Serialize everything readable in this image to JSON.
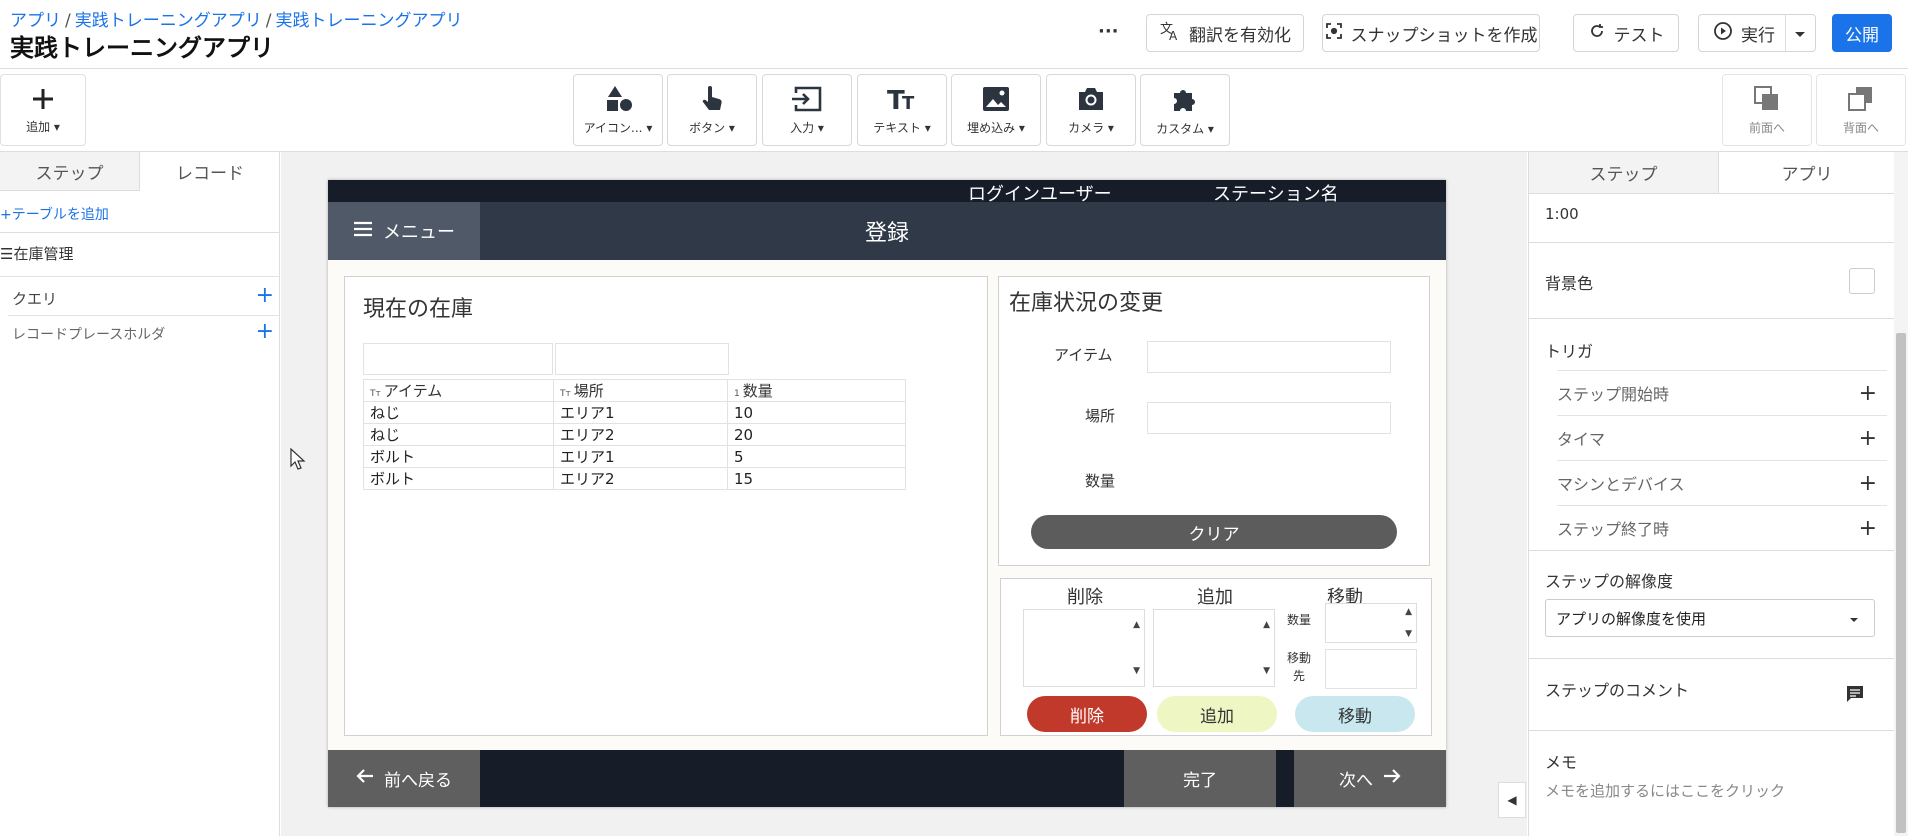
{
  "header": {
    "breadcrumb": [
      "アプリ",
      "実践トレーニングアプリ",
      "実践トレーニングアプリ"
    ],
    "title": "実践トレーニングアプリ",
    "more_label": "···",
    "translate_label": "翻訳を有効化",
    "snapshot_label": "スナップショットを作成",
    "test_label": "テスト",
    "run_label": "実行",
    "publish_label": "公開"
  },
  "toolbar": {
    "add_label": "追加",
    "items": [
      "アイコン...",
      "ボタン",
      "入力",
      "テキスト",
      "埋め込み",
      "カメラ",
      "カスタム"
    ],
    "bring_front_label": "前面へ",
    "send_back_label": "背面へ"
  },
  "left_panel": {
    "tabs": [
      "ステップ",
      "レコード"
    ],
    "active_tab": "レコード",
    "add_table_label": "テーブルを追加",
    "table_name": "在庫管理",
    "query_label": "クエリ",
    "placeholder_label": "レコードプレースホルダ"
  },
  "device": {
    "top_bar": {
      "user_label": "ログインユーザー",
      "station_label": "ステーション名"
    },
    "menu_label": "メニュー",
    "screen_title": "登録",
    "inventory": {
      "title": "現在の在庫",
      "columns": [
        "アイテム",
        "場所",
        "数量"
      ],
      "column_type_icons": [
        "Tт",
        "Tт",
        "1"
      ],
      "rows": [
        [
          "ねじ",
          "エリア1",
          "10"
        ],
        [
          "ねじ",
          "エリア2",
          "20"
        ],
        [
          "ボルト",
          "エリア1",
          "5"
        ],
        [
          "ボルト",
          "エリア2",
          "15"
        ]
      ]
    },
    "change": {
      "title": "在庫状況の変更",
      "item_label": "アイテム",
      "location_label": "場所",
      "quantity_label": "数量",
      "clear_label": "クリア"
    },
    "actions": {
      "delete_heading": "削除",
      "add_heading": "追加",
      "move_heading": "移動",
      "qty_label": "数量",
      "dest_label_1": "移動",
      "dest_label_2": "先",
      "delete_button": "削除",
      "add_button": "追加",
      "move_button": "移動",
      "delete_color": "#c0392b",
      "add_color": "#eef6c4",
      "move_color": "#c9e7ee"
    },
    "footer": {
      "back_label": "前へ戻る",
      "done_label": "完了",
      "next_label": "次へ"
    }
  },
  "right_panel": {
    "tabs": [
      "ステップ",
      "アプリ"
    ],
    "active_tab": "ステップ",
    "time_value": "1:00",
    "bg_color_label": "背景色",
    "trigger_label": "トリガ",
    "triggers": [
      "ステップ開始時",
      "タイマ",
      "マシンとデバイス",
      "ステップ終了時"
    ],
    "resolution_label": "ステップの解像度",
    "resolution_value": "アプリの解像度を使用",
    "comment_label": "ステップのコメント",
    "memo_label": "メモ",
    "memo_placeholder": "メモを追加するにはここをクリック"
  }
}
